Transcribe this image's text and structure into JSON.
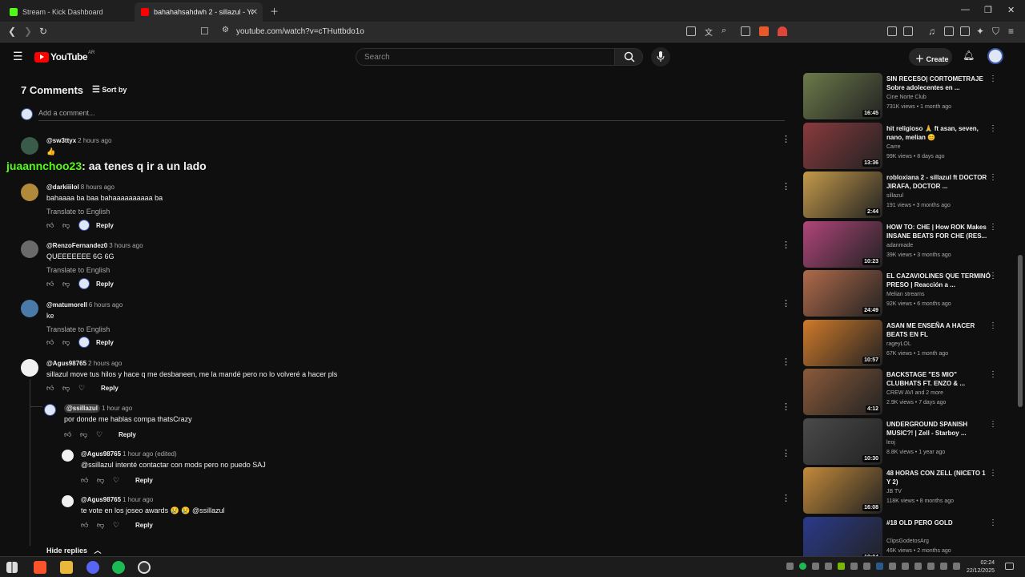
{
  "browser": {
    "tabs": [
      {
        "title": "Stream - Kick Dashboard"
      },
      {
        "title": "bahahahsahdwh 2 - sillazul - Yo"
      }
    ],
    "url": "youtube.com/watch?v=cTHuttbdo1o"
  },
  "youtube": {
    "logo_text": "YouTube",
    "region": "AR",
    "search_placeholder": "Search",
    "create_label": "Create"
  },
  "comments": {
    "count_label": "7 Comments",
    "sort_label": "Sort by",
    "add_placeholder": "Add a comment...",
    "translate_label": "Translate to English",
    "reply_label": "Reply",
    "hide_replies_label": "Hide replies",
    "items": [
      {
        "author": "@sw3ttyx",
        "time": "2 hours ago",
        "text": "👍"
      },
      {
        "author": "@darkiiilol",
        "time": "8 hours ago",
        "text": "bahaaaa ba baa bahaaaaaaaaaa ba"
      },
      {
        "author": "@RenzoFernandez0",
        "time": "3 hours ago",
        "text": "QUEEEEEEE 6G 6G"
      },
      {
        "author": "@matumorell",
        "time": "6 hours ago",
        "text": "ke"
      },
      {
        "author": "@Agus98765",
        "time": "2 hours ago",
        "text": "sillazul move tus hilos y hace q me desbaneen, me la mandé pero no lo volveré a hacer pls"
      }
    ],
    "replies": [
      {
        "author": "@ssillazul",
        "time": "1 hour ago",
        "text": "por donde me hablas compa thatsCrazy"
      },
      {
        "author": "@Agus98765",
        "time": "1 hour ago (edited)",
        "text": "@ssillazul intenté contactar con mods pero no puedo SAJ"
      },
      {
        "author": "@Agus98765",
        "time": "1 hour ago",
        "text": "te vote en los joseo awards 😢 😢 @ssillazul"
      }
    ]
  },
  "overlay_chat": {
    "user": "juaannchoo23",
    "message": ": aa tenes q ir a un lado"
  },
  "recommended": [
    {
      "title": "SIN RECESO| CORTOMETRAJE Sobre adolecentes en ...",
      "channel": "Cine Norte Club",
      "meta": "731K views • 1 month ago",
      "duration": "16:45",
      "color": "#6c7a4a"
    },
    {
      "title": "hit religioso 🙏 ft asan, seven, nano, melian 😊",
      "channel": "Carre",
      "meta": "99K views • 8 days ago",
      "duration": "13:36",
      "color": "#8a3a3e"
    },
    {
      "title": "robloxiana 2 - sillazul ft DOCTOR JIRAFA, DOCTOR ...",
      "channel": "sillazul",
      "meta": "191 views • 3 months ago",
      "duration": "2:44",
      "color": "#c49a4a"
    },
    {
      "title": "HOW TO: CHE | How ROK Makes INSANE BEATS FOR CHE (RES...",
      "channel": "adanmade",
      "meta": "39K views • 3 months ago",
      "duration": "10:23",
      "color": "#b0457a"
    },
    {
      "title": "EL CAZAVIOLINES QUE TERMINÓ PRESO | Reacción a ...",
      "channel": "Melian streams",
      "meta": "92K views • 6 months ago",
      "duration": "24:49",
      "color": "#b06a4a"
    },
    {
      "title": "ASAN ME ENSEÑA A HACER BEATS EN FL",
      "channel": "rageyLOL",
      "meta": "67K views • 1 month ago",
      "duration": "10:57",
      "color": "#d07a2a"
    },
    {
      "title": "BACKSTAGE \"ES MIO\" CLUBHATS FT. ENZO & ...",
      "channel": "CREW AVI and 2 more",
      "meta": "2.9K views • 7 days ago",
      "duration": "4:12",
      "color": "#8a5a3a"
    },
    {
      "title": "UNDERGROUND SPANISH MUSIC?! | Zell - Starboy ...",
      "channel": "leoj",
      "meta": "8.8K views • 1 year ago",
      "duration": "10:30",
      "color": "#4a4a4a"
    },
    {
      "title": "48 HORAS CON ZELL (NICETO 1 Y 2)",
      "channel": "JB TV",
      "meta": "118K views • 8 months ago",
      "duration": "16:08",
      "color": "#c48a3a"
    },
    {
      "title": "#18 OLD PERO GOLD",
      "channel": "ClipsGodetosArg",
      "meta": "46K views • 2 months ago",
      "duration": "10:04",
      "color": "#2a3a8a"
    }
  ],
  "taskbar": {
    "time": "02:24",
    "date": "22/12/2025"
  }
}
